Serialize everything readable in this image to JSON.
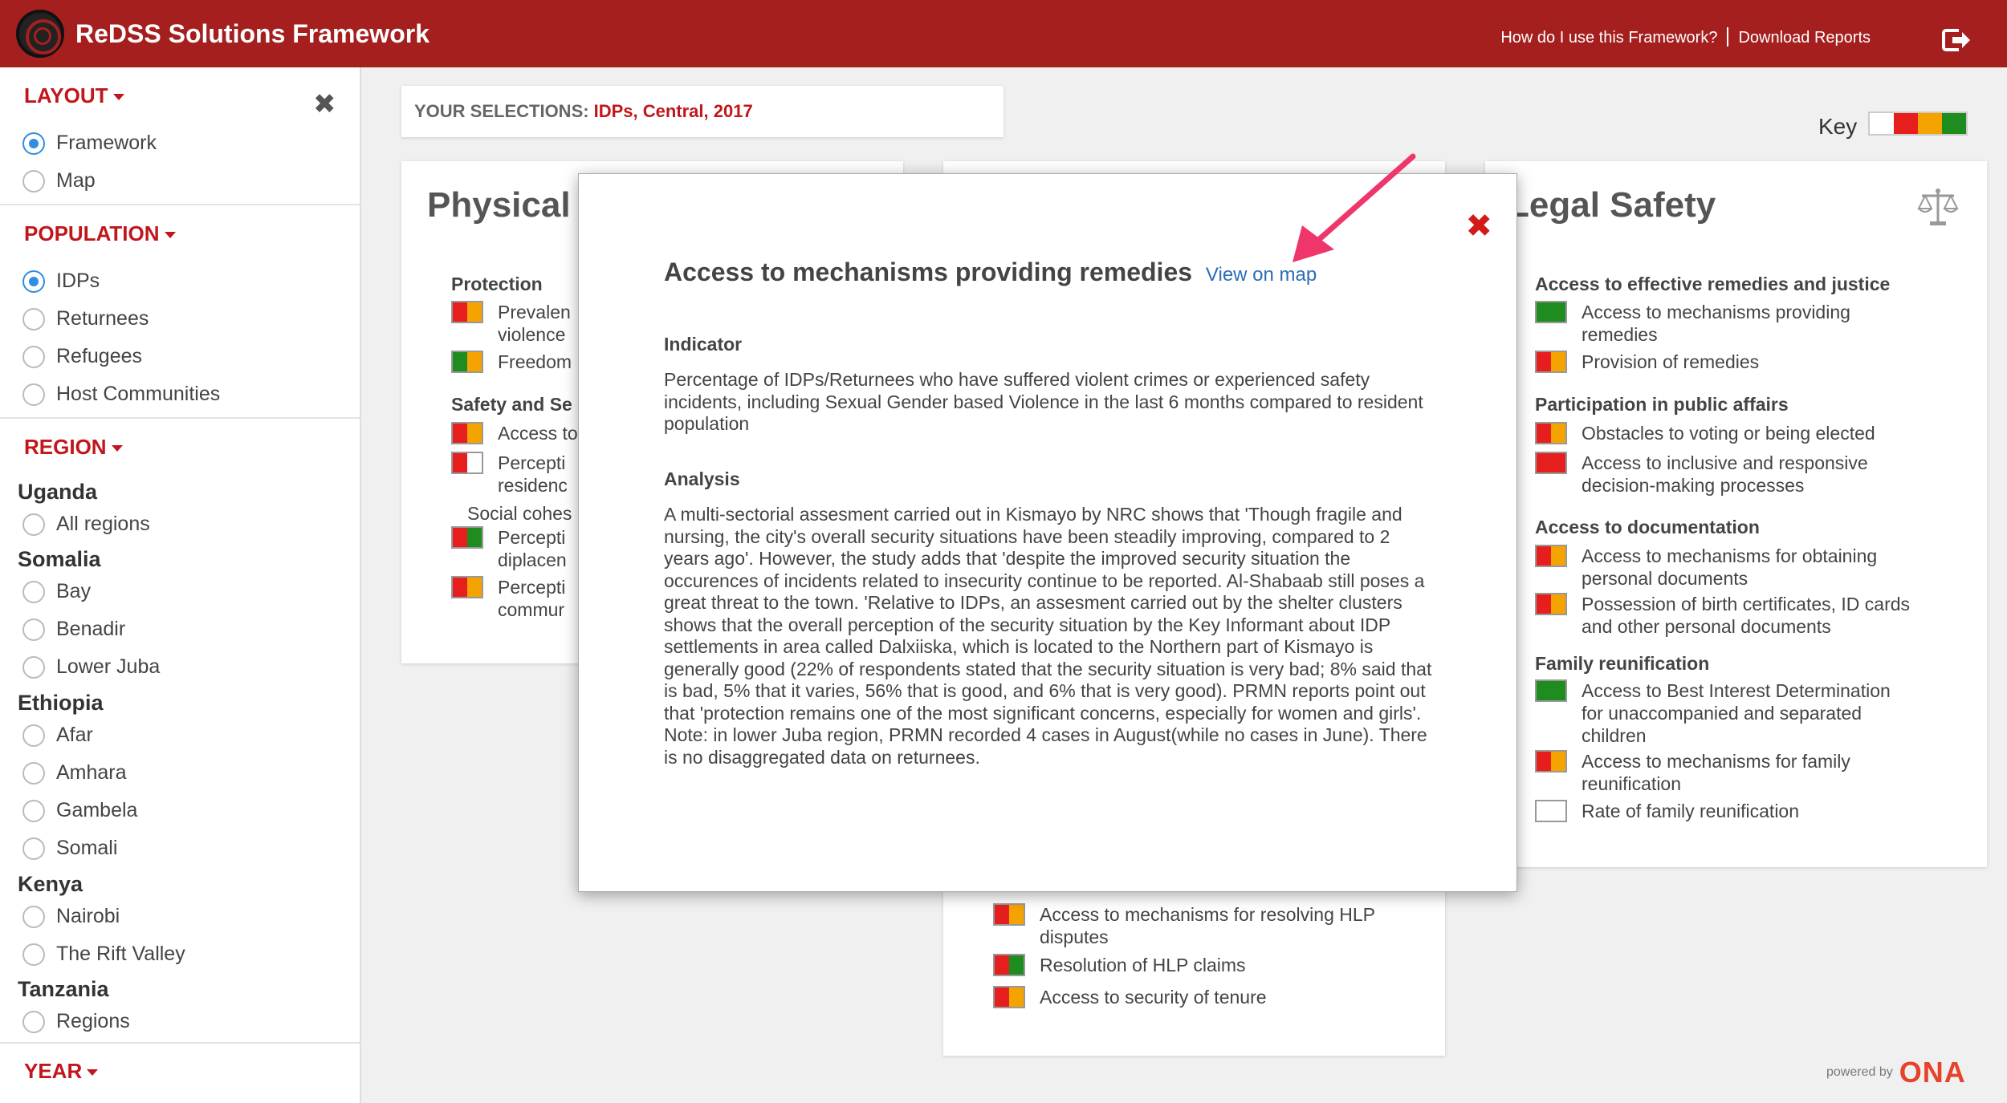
{
  "header": {
    "title": "ReDSS Solutions Framework",
    "link_help": "How do I use this Framework?",
    "link_download": "Download Reports"
  },
  "sidebar": {
    "layout": {
      "label": "LAYOUT",
      "options": [
        "Framework",
        "Map"
      ],
      "selected": "Framework"
    },
    "population": {
      "label": "POPULATION",
      "options": [
        "IDPs",
        "Returnees",
        "Refugees",
        "Host Communities"
      ],
      "selected": "IDPs"
    },
    "region": {
      "label": "REGION",
      "countries": [
        {
          "name": "Uganda",
          "regions": [
            "All regions"
          ]
        },
        {
          "name": "Somalia",
          "regions": [
            "Bay",
            "Benadir",
            "Lower Juba"
          ]
        },
        {
          "name": "Ethiopia",
          "regions": [
            "Afar",
            "Amhara",
            "Gambela",
            "Somali"
          ]
        },
        {
          "name": "Kenya",
          "regions": [
            "Nairobi",
            "The Rift Valley"
          ]
        },
        {
          "name": "Tanzania",
          "regions": [
            "Regions"
          ]
        }
      ]
    },
    "year": {
      "label": "YEAR"
    }
  },
  "selections": {
    "label": "YOUR SELECTIONS:",
    "value": "IDPs, Central, 2017"
  },
  "key": {
    "label": "Key",
    "colors": [
      "#ffffff",
      "#e61e1e",
      "#f5a300",
      "#1e8c1e"
    ]
  },
  "colors": {
    "red": "#e61e1e",
    "orange": "#f5a300",
    "green": "#1e8c1e",
    "white": "#ffffff",
    "brand": "#a51f1f"
  },
  "physical_card": {
    "title": "Physical Safety",
    "title_visible": "Physical",
    "groups": [
      {
        "title": "Protection",
        "items": [
          {
            "label_lines": [
              "Prevalen",
              "violence"
            ],
            "colors": [
              "red",
              "orange"
            ]
          },
          {
            "label_lines": [
              "Freedom"
            ],
            "colors": [
              "green",
              "orange"
            ]
          }
        ]
      },
      {
        "title": "Safety and Se",
        "items": [
          {
            "label_lines": [
              "Access to"
            ],
            "colors": [
              "red",
              "orange"
            ]
          },
          {
            "label_lines": [
              "Percepti",
              "residenc"
            ],
            "colors": [
              "red",
              "white"
            ]
          }
        ]
      },
      {
        "title": "Social cohes",
        "items": [
          {
            "label_lines": [
              "Percepti",
              "diplacen"
            ],
            "colors": [
              "red",
              "green"
            ]
          },
          {
            "label_lines": [
              "Percepti",
              "commur"
            ],
            "colors": [
              "red",
              "orange"
            ]
          }
        ]
      }
    ]
  },
  "hlp_card": {
    "items": [
      {
        "label_lines": [
          "Access to mechanisms for resolving HLP",
          "disputes"
        ],
        "colors": [
          "red",
          "orange"
        ]
      },
      {
        "label_lines": [
          "Resolution of HLP claims"
        ],
        "colors": [
          "red",
          "green"
        ]
      },
      {
        "label_lines": [
          "Access to security of tenure"
        ],
        "colors": [
          "red",
          "orange"
        ]
      }
    ]
  },
  "legal_card": {
    "title": "Legal Safety",
    "groups": [
      {
        "title": "Access to effective remedies and justice",
        "items": [
          {
            "label_lines": [
              "Access to mechanisms providing",
              "remedies"
            ],
            "colors": [
              "green",
              "green"
            ]
          },
          {
            "label_lines": [
              "Provision of remedies"
            ],
            "colors": [
              "red",
              "orange"
            ]
          }
        ]
      },
      {
        "title": "Participation in public affairs",
        "items": [
          {
            "label_lines": [
              "Obstacles to voting or being elected"
            ],
            "colors": [
              "red",
              "orange"
            ]
          },
          {
            "label_lines": [
              "Access to inclusive and responsive",
              "decision-making processes"
            ],
            "colors": [
              "red",
              "red"
            ]
          }
        ]
      },
      {
        "title": "Access to documentation",
        "items": [
          {
            "label_lines": [
              "Access to mechanisms for obtaining",
              "personal documents"
            ],
            "colors": [
              "red",
              "orange"
            ]
          },
          {
            "label_lines": [
              "Possession of birth certificates, ID cards",
              "and other personal documents"
            ],
            "colors": [
              "red",
              "orange"
            ]
          }
        ]
      },
      {
        "title": "Family reunification",
        "items": [
          {
            "label_lines": [
              "Access to Best Interest Determination",
              "for unaccompanied and separated",
              "children"
            ],
            "colors": [
              "green",
              "green"
            ]
          },
          {
            "label_lines": [
              "Access to mechanisms for family",
              "reunification"
            ],
            "colors": [
              "red",
              "orange"
            ]
          },
          {
            "label_lines": [
              "Rate of family reunification"
            ],
            "colors": [
              "white",
              "white"
            ]
          }
        ]
      }
    ]
  },
  "modal": {
    "title": "Access to mechanisms providing remedies",
    "map_link": "View on map",
    "indicator_label": "Indicator",
    "indicator_text": "Percentage of IDPs/Returnees who have suffered violent crimes or experienced safety incidents, including Sexual Gender based Violence in the last 6 months compared to resident population",
    "analysis_label": "Analysis",
    "analysis_text": "A multi-sectorial assesment carried out in Kismayo by NRC shows that 'Though fragile and nursing, the city's overall security situations have been steadily improving, compared to 2 years ago'. However, the study adds that 'despite the improved security situation the occurences of incidents related to insecurity continue to be reported. Al-Shabaab still poses a great threat to the town. 'Relative to IDPs, an assesment carried out by the shelter clusters shows that the overall perception of the security situation by the Key Informant about IDP settlements in area called Dalxiiska, which is located to the Northern part of Kismayo is generally good (22% of respondents stated that the security situation is very bad; 8% said that is bad, 5% that it varies, 56% that is good, and 6% that is very good). PRMN reports point out that 'protection remains one of the most significant concerns, especially for women and girls'. Note: in lower Juba region, PRMN recorded 4 cases in August(while no cases in June). There is no disaggregated data on returnees."
  },
  "footer": {
    "powered_by": "powered by",
    "brand": "ONA"
  }
}
